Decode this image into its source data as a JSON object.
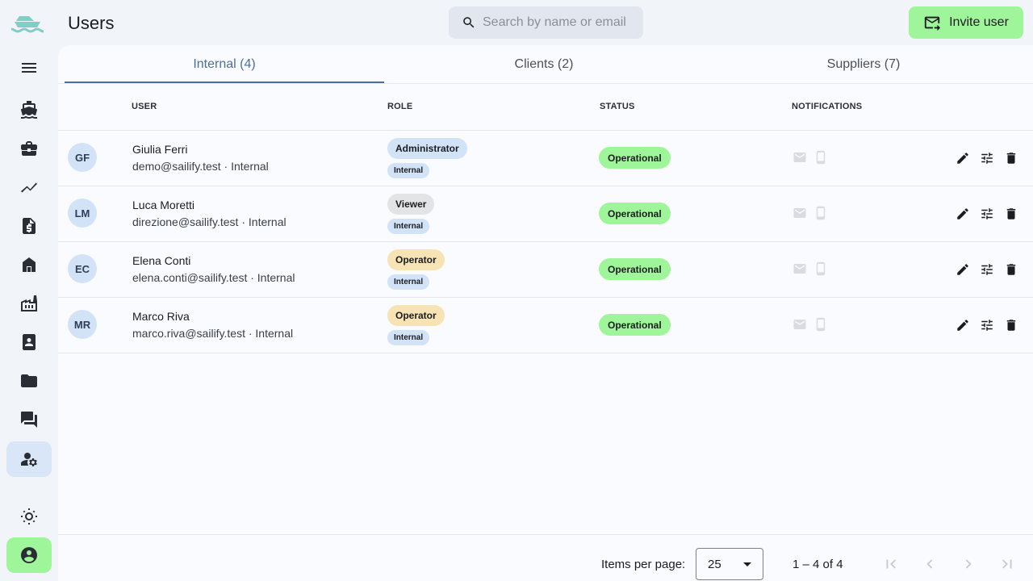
{
  "header": {
    "title": "Users",
    "search_placeholder": "Search by name or email",
    "invite_label": "Invite user"
  },
  "sidebar": {
    "items": [
      {
        "name": "menu-icon"
      },
      {
        "name": "boat-icon"
      },
      {
        "name": "briefcase-icon"
      },
      {
        "name": "trending-icon"
      },
      {
        "name": "invoice-icon"
      },
      {
        "name": "store-icon"
      },
      {
        "name": "factory-icon"
      },
      {
        "name": "contact-document-icon"
      },
      {
        "name": "folder-icon"
      },
      {
        "name": "forum-icon"
      },
      {
        "name": "manage-accounts-icon",
        "active": true
      },
      {
        "name": "theme-toggle-icon"
      },
      {
        "name": "account-circle-icon"
      }
    ]
  },
  "tabs": [
    {
      "label": "Internal (4)",
      "active": true
    },
    {
      "label": "Clients (2)",
      "active": false
    },
    {
      "label": "Suppliers (7)",
      "active": false
    }
  ],
  "table": {
    "columns": [
      "USER",
      "ROLE",
      "STATUS",
      "NOTIFICATIONS"
    ],
    "rows": [
      {
        "initials": "GF",
        "name": "Giulia Ferri",
        "sub": "demo@sailify.test · Internal",
        "role": "Administrator",
        "role_color": "#d2e3f8",
        "type": "Internal",
        "status": "Operational"
      },
      {
        "initials": "LM",
        "name": "Luca Moretti",
        "sub": "direzione@sailify.test · Internal",
        "role": "Viewer",
        "role_color": "#e3e4e6",
        "type": "Internal",
        "status": "Operational"
      },
      {
        "initials": "EC",
        "name": "Elena Conti",
        "sub": "elena.conti@sailify.test · Internal",
        "role": "Operator",
        "role_color": "#f7e3b4",
        "type": "Internal",
        "status": "Operational"
      },
      {
        "initials": "MR",
        "name": "Marco Riva",
        "sub": "marco.riva@sailify.test · Internal",
        "role": "Operator",
        "role_color": "#f7e3b4",
        "type": "Internal",
        "status": "Operational"
      }
    ]
  },
  "paginator": {
    "items_per_page_label": "Items per page:",
    "page_size": "25",
    "range": "1 – 4 of 4"
  },
  "colors": {
    "accent": "#4d6e99",
    "status_operational": "#9ff59a",
    "invite_button": "#9ff59a"
  }
}
